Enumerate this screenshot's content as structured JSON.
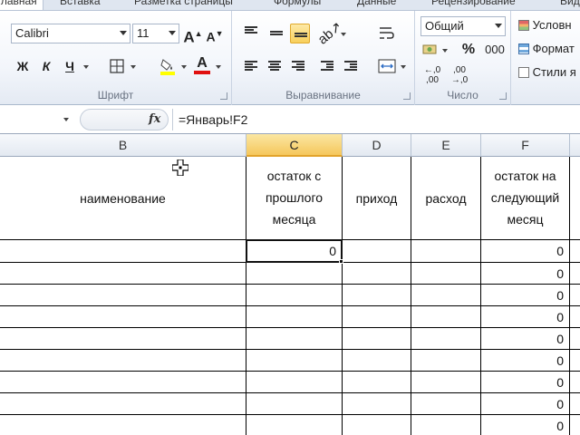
{
  "ribbon": {
    "tabs": [
      "Главная",
      "Вставка",
      "Разметка страницы",
      "Формулы",
      "Данные",
      "Рецензирование",
      "Вид"
    ],
    "font": {
      "name": "Calibri",
      "size": "11",
      "grow_label": "A",
      "shrink_label": "A",
      "bold_label": "Ж",
      "italic_label": "К",
      "underline_label": "Ч",
      "font_color_label": "A",
      "group_label": "Шрифт"
    },
    "alignment": {
      "group_label": "Выравнивание"
    },
    "number": {
      "format": "Общий",
      "percent_label": "%",
      "thousands_label": "000",
      "group_label": "Число"
    },
    "styles": {
      "conditional_label": "Условн",
      "format_label": "Формат",
      "cell_styles_label": "Стили я"
    }
  },
  "formula_bar": {
    "name_box": "",
    "fx_label": "fx",
    "formula": "=Январь!F2"
  },
  "columns": [
    "B",
    "C",
    "D",
    "E",
    "F"
  ],
  "header_row": {
    "B": "наименование",
    "C": [
      "остаток с",
      "прошлого",
      "месяца"
    ],
    "D": "приход",
    "E": "расход",
    "F": [
      "остаток на",
      "следующий",
      "месяц"
    ]
  },
  "rows": [
    {
      "C": "0",
      "F": "0"
    },
    {
      "C": "",
      "F": "0"
    },
    {
      "C": "",
      "F": "0"
    },
    {
      "C": "",
      "F": "0"
    },
    {
      "C": "",
      "F": "0"
    },
    {
      "C": "",
      "F": "0"
    },
    {
      "C": "",
      "F": "0"
    },
    {
      "C": "",
      "F": "0"
    },
    {
      "C": "",
      "F": "0"
    }
  ],
  "colors": {
    "selected_header": "#f5c75c",
    "ribbon_bg": "#f3f6fb"
  }
}
